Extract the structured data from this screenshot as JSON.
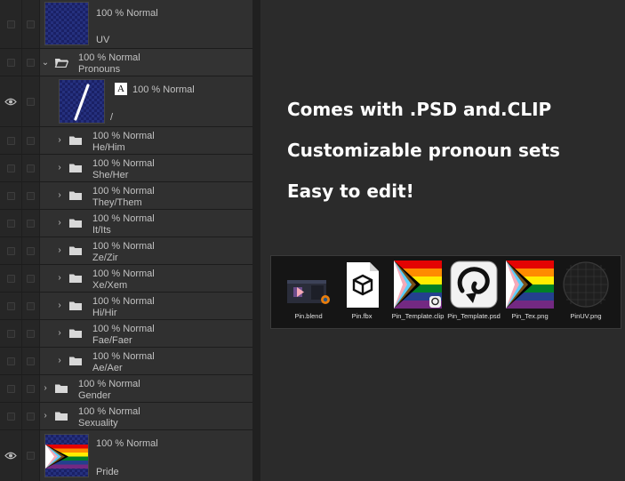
{
  "layers_panel": {
    "rows": [
      {
        "opacity": "100 %",
        "blend": "Normal",
        "name": "UV"
      },
      {
        "opacity": "100 %",
        "blend": "Normal",
        "name": "Pronouns"
      },
      {
        "opacity": "100 %",
        "blend": "Normal",
        "name": "/",
        "badge": "A"
      },
      {
        "opacity": "100 %",
        "blend": "Normal",
        "name": "He/Him"
      },
      {
        "opacity": "100 %",
        "blend": "Normal",
        "name": "She/Her"
      },
      {
        "opacity": "100 %",
        "blend": "Normal",
        "name": "They/Them"
      },
      {
        "opacity": "100 %",
        "blend": "Normal",
        "name": "It/Its"
      },
      {
        "opacity": "100 %",
        "blend": "Normal",
        "name": "Ze/Zir"
      },
      {
        "opacity": "100 %",
        "blend": "Normal",
        "name": "Xe/Xem"
      },
      {
        "opacity": "100 %",
        "blend": "Normal",
        "name": "Hi/Hir"
      },
      {
        "opacity": "100 %",
        "blend": "Normal",
        "name": "Fae/Faer"
      },
      {
        "opacity": "100 %",
        "blend": "Normal",
        "name": "Ae/Aer"
      },
      {
        "opacity": "100 %",
        "blend": "Normal",
        "name": "Gender"
      },
      {
        "opacity": "100 %",
        "blend": "Normal",
        "name": "Sexuality"
      },
      {
        "opacity": "100 %",
        "blend": "Normal",
        "name": "Pride"
      }
    ]
  },
  "headlines": [
    "Comes with .PSD and.CLIP",
    "Customizable pronoun sets",
    "Easy to edit!"
  ],
  "file_explorer": {
    "files": [
      {
        "name": "Pin.blend",
        "icon": "blender-file-icon"
      },
      {
        "name": "Pin.fbx",
        "icon": "fbx-file-icon"
      },
      {
        "name": "Pin_Template.clip",
        "icon": "clip-studio-file-icon"
      },
      {
        "name": "Pin_Template.psd",
        "icon": "clip-studio-app-icon"
      },
      {
        "name": "Pin_Tex.png",
        "icon": "image-file-icon"
      },
      {
        "name": "PinUV.png",
        "icon": "uv-image-file-icon"
      }
    ]
  },
  "colors": {
    "panel_bg": "#2c2c2c",
    "page_bg": "#2b2b2b",
    "headline_text": "#ffffff",
    "explorer_bg": "#151515",
    "thumb_blue": "#1a2166"
  }
}
